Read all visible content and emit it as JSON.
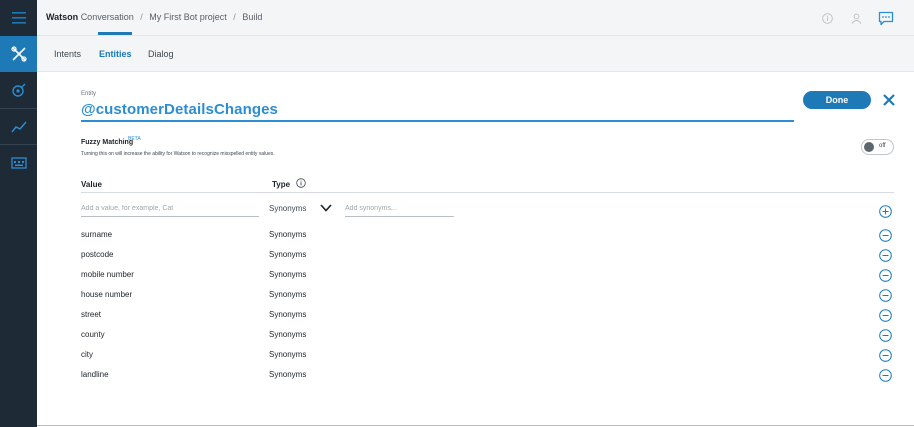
{
  "header": {
    "app_name": "Watson",
    "app_suffix": "Conversation",
    "project": "My First Bot project",
    "page": "Build",
    "separator": "/"
  },
  "tabs": [
    {
      "label": "Intents"
    },
    {
      "label": "Entities"
    },
    {
      "label": "Dialog"
    }
  ],
  "entity": {
    "label": "Entity",
    "name": "@customerDetailsChanges"
  },
  "actions": {
    "done_label": "Done"
  },
  "fuzzy": {
    "title": "Fuzzy Matching",
    "beta": "BETA",
    "description": "Turning this on will increase the ability for Watson to recognize misspelled entity values.",
    "toggle_state": "off"
  },
  "table": {
    "value_header": "Value",
    "type_header": "Type",
    "new_value_placeholder": "Add a value, for example, Cat",
    "new_type": "Synonyms",
    "synonyms_placeholder": "Add synonyms...",
    "rows": [
      {
        "value": "surname",
        "type": "Synonyms"
      },
      {
        "value": "postcode",
        "type": "Synonyms"
      },
      {
        "value": "mobile number",
        "type": "Synonyms"
      },
      {
        "value": "house number",
        "type": "Synonyms"
      },
      {
        "value": "street",
        "type": "Synonyms"
      },
      {
        "value": "county",
        "type": "Synonyms"
      },
      {
        "value": "city",
        "type": "Synonyms"
      },
      {
        "value": "landline",
        "type": "Synonyms"
      }
    ]
  },
  "colors": {
    "accent": "#1d7ab6",
    "entity_blue": "#2b8ed2",
    "rail": "#1e2a35"
  }
}
